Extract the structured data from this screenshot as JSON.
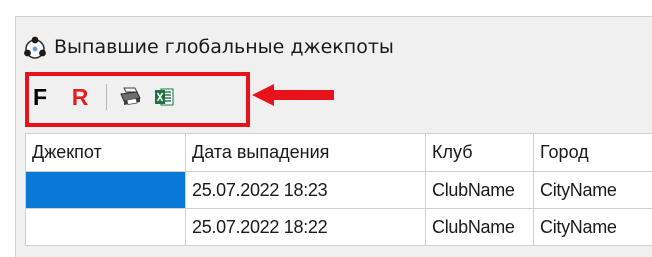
{
  "window": {
    "title": "Выпавшие глобальные джекпоты",
    "icon": "jackpot-app-icon"
  },
  "toolbar": {
    "f_label": "F",
    "r_label": "R",
    "print_icon": "printer-icon",
    "excel_icon": "excel-icon"
  },
  "annotation": {
    "highlight_color": "#e8121b",
    "arrow_color": "#e8121b"
  },
  "table": {
    "columns": [
      "Джекпот",
      "Дата выпадения",
      "Клуб",
      "Город"
    ],
    "rows": [
      {
        "jackpot": "",
        "date": "25.07.2022 18:23",
        "club": "ClubName",
        "city": "CityName",
        "selected": true
      },
      {
        "jackpot": "",
        "date": "25.07.2022 18:22",
        "club": "ClubName",
        "city": "CityName",
        "selected": false
      }
    ],
    "selection_color": "#0a78d7"
  }
}
